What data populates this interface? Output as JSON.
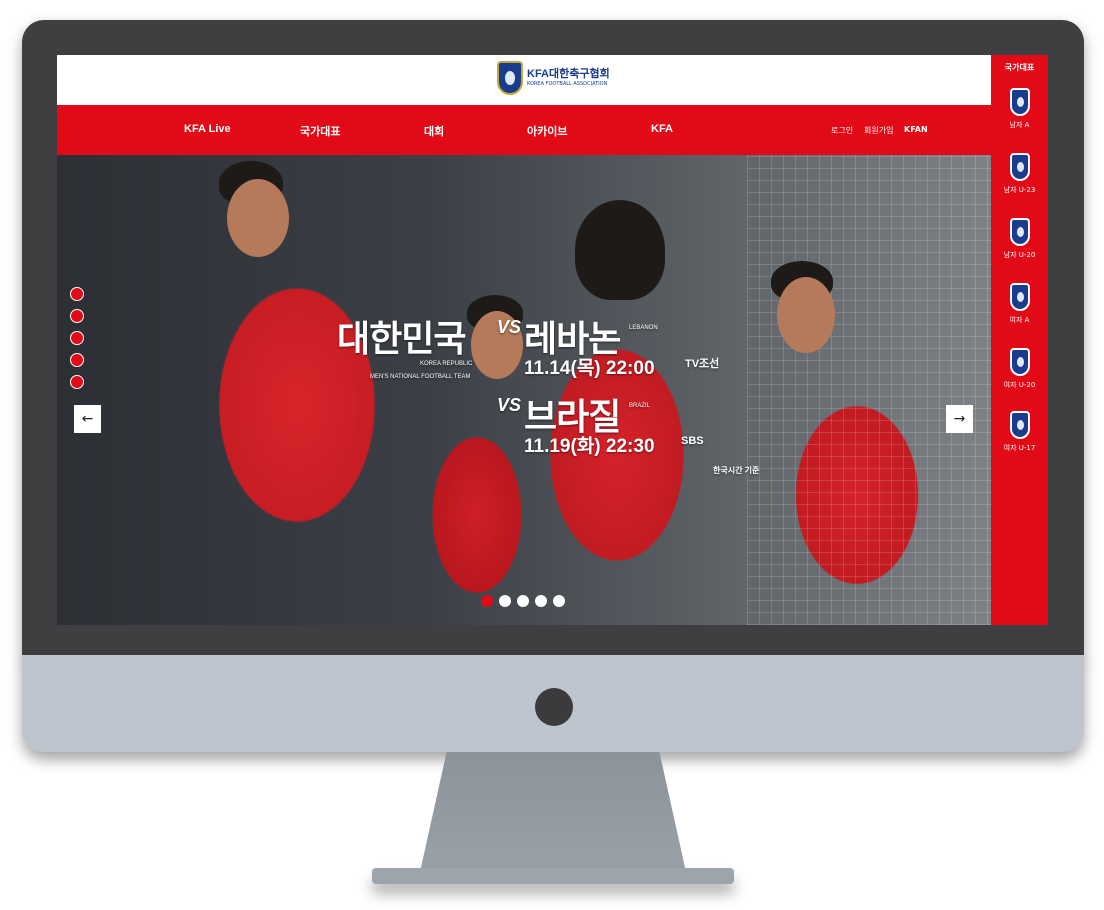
{
  "header": {
    "logo_text": "KFA대한축구협회",
    "logo_sub": "KOREA FOOTBALL ASSOCIATION"
  },
  "nav": {
    "items": [
      "KFA Live",
      "국가대표",
      "대회",
      "아카이브",
      "KFA"
    ],
    "utility": [
      "로그인",
      "회원가입",
      "KFAN"
    ]
  },
  "hero": {
    "team_kr": "대한민국",
    "team_en_line1": "KOREA REPUBLIC",
    "team_en_line2": "MEN'S NATIONAL FOOTBALL TEAM",
    "vs": "VS",
    "match1": {
      "opponent": "레바논",
      "opponent_en": "LEBANON",
      "datetime": "11.14(목) 22:00",
      "broadcaster": "TV조선"
    },
    "match2": {
      "opponent": "브라질",
      "opponent_en": "BRAZIL",
      "datetime": "11.19(화) 22:30",
      "broadcaster": "SBS"
    },
    "timezone_note": "한국시간 기준",
    "prev_arrow": "←",
    "next_arrow": "→",
    "slide_count": 5,
    "active_slide": 1
  },
  "sidebar": {
    "title": "국가대표",
    "items": [
      "남자 A",
      "남자 U-23",
      "남자 U-20",
      "여자 A",
      "여자 U-20",
      "여자 U-17"
    ]
  },
  "colors": {
    "brand_red": "#e20a17",
    "brand_blue": "#1a3c8c"
  }
}
